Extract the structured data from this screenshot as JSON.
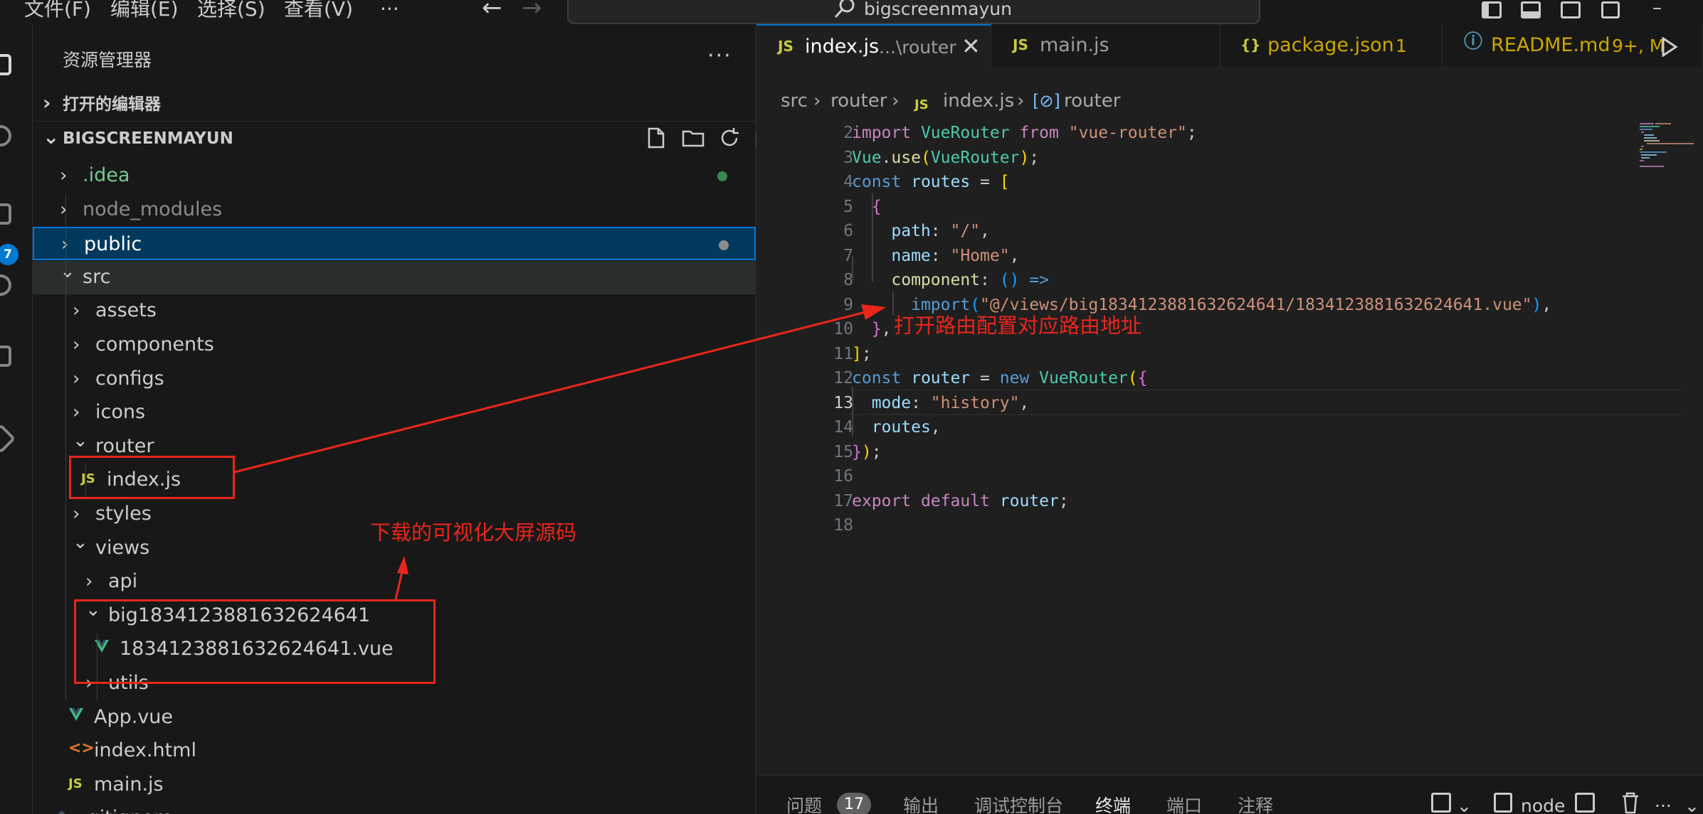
{
  "colors": {
    "accent": "#0078d4",
    "annotation": "#e8261c",
    "background": "#1f1f1f",
    "sidebar_bg": "#181818"
  },
  "titlebar": {
    "menu": [
      "文件(F)",
      "编辑(E)",
      "选择(S)",
      "查看(V)",
      "···"
    ],
    "search_text": "bigscreenmayun",
    "back_icon": "arrow-left-icon",
    "forward_icon": "arrow-right-icon",
    "search_icon": "search-icon",
    "minimize": "–"
  },
  "activitybar": {
    "scm_badge": "7"
  },
  "sidebar": {
    "title": "资源管理器",
    "more": "···",
    "open_editors": "打开的编辑器",
    "project": "BIGSCREENMAYUN",
    "tree": [
      {
        "label": ".idea",
        "type": "folder",
        "expanded": false,
        "depth": 0,
        "color": "#73c991",
        "dot": "#3a8a4f"
      },
      {
        "label": "node_modules",
        "type": "folder",
        "expanded": false,
        "depth": 0,
        "color": "#8c8c8c"
      },
      {
        "label": "public",
        "type": "folder",
        "expanded": false,
        "depth": 0,
        "color": "#ffffff",
        "dot": "#8c8c8c",
        "selected": true
      },
      {
        "label": "src",
        "type": "folder",
        "expanded": true,
        "depth": 0,
        "color": "#cccccc",
        "hover": true
      },
      {
        "label": "assets",
        "type": "folder",
        "expanded": false,
        "depth": 1,
        "color": "#cccccc"
      },
      {
        "label": "components",
        "type": "folder",
        "expanded": false,
        "depth": 1,
        "color": "#cccccc"
      },
      {
        "label": "configs",
        "type": "folder",
        "expanded": false,
        "depth": 1,
        "color": "#cccccc"
      },
      {
        "label": "icons",
        "type": "folder",
        "expanded": false,
        "depth": 1,
        "color": "#cccccc"
      },
      {
        "label": "router",
        "type": "folder",
        "expanded": true,
        "depth": 1,
        "color": "#cccccc"
      },
      {
        "label": "index.js",
        "type": "js",
        "depth": 2,
        "color": "#cccccc"
      },
      {
        "label": "styles",
        "type": "folder",
        "expanded": false,
        "depth": 1,
        "color": "#cccccc"
      },
      {
        "label": "views",
        "type": "folder",
        "expanded": true,
        "depth": 1,
        "color": "#cccccc"
      },
      {
        "label": "api",
        "type": "folder",
        "expanded": false,
        "depth": 2,
        "color": "#cccccc"
      },
      {
        "label": "big1834123881632624641",
        "type": "folder",
        "expanded": true,
        "depth": 2,
        "color": "#cccccc"
      },
      {
        "label": "1834123881632624641.vue",
        "type": "vue",
        "depth": 3,
        "color": "#cccccc"
      },
      {
        "label": "utils",
        "type": "folder",
        "expanded": false,
        "depth": 2,
        "color": "#cccccc"
      },
      {
        "label": "App.vue",
        "type": "vue",
        "depth": 1,
        "color": "#cccccc"
      },
      {
        "label": "index.html",
        "type": "html",
        "depth": 1,
        "color": "#cccccc"
      },
      {
        "label": "main.js",
        "type": "js",
        "depth": 1,
        "color": "#cccccc"
      },
      {
        "label": ".gitignore",
        "type": "git",
        "depth": 0,
        "color": "#cccccc"
      }
    ]
  },
  "tabs": [
    {
      "icon": "JS",
      "name": "index.js",
      "desc": "...\\router",
      "active": true,
      "name_color": "#ffffff",
      "close": "✕"
    },
    {
      "icon": "JS",
      "name": "main.js",
      "name_color": "#9d9d9d"
    },
    {
      "icon": "{}",
      "name": "package.json",
      "desc": "1",
      "name_color": "#cca700"
    },
    {
      "icon": "ⓘ",
      "name": "README.md",
      "desc": "9+, M",
      "name_color": "#cca700"
    }
  ],
  "breadcrumb": [
    "src",
    "router",
    "index.js",
    "router"
  ],
  "editor": {
    "current_line": 13,
    "lines": [
      {
        "n": 2,
        "tokens": [
          [
            "k",
            "import"
          ],
          [
            "pl",
            " "
          ],
          [
            "t",
            "VueRouter"
          ],
          [
            "pl",
            " "
          ],
          [
            "k",
            "from"
          ],
          [
            "pl",
            " "
          ],
          [
            "s",
            "\"vue-router\""
          ],
          [
            "pl",
            ";"
          ]
        ]
      },
      {
        "n": 3,
        "tokens": [
          [
            "t",
            "Vue"
          ],
          [
            "pl",
            "."
          ],
          [
            "f",
            "use"
          ],
          [
            "b1",
            "("
          ],
          [
            "t",
            "VueRouter"
          ],
          [
            "b1",
            ")"
          ],
          [
            "pl",
            ";"
          ]
        ]
      },
      {
        "n": 4,
        "tokens": [
          [
            "kw",
            "const"
          ],
          [
            "pl",
            " "
          ],
          [
            "v",
            "routes"
          ],
          [
            "pl",
            " = "
          ],
          [
            "b1",
            "["
          ]
        ]
      },
      {
        "n": 5,
        "tokens": [
          [
            "pl",
            "  "
          ],
          [
            "b2",
            "{"
          ]
        ]
      },
      {
        "n": 6,
        "tokens": [
          [
            "pl",
            "    "
          ],
          [
            "v",
            "path"
          ],
          [
            "pl",
            ": "
          ],
          [
            "s",
            "\"/\""
          ],
          [
            "pl",
            ","
          ]
        ]
      },
      {
        "n": 7,
        "tokens": [
          [
            "pl",
            "    "
          ],
          [
            "v",
            "name"
          ],
          [
            "pl",
            ": "
          ],
          [
            "s",
            "\"Home\""
          ],
          [
            "pl",
            ","
          ]
        ]
      },
      {
        "n": 8,
        "tokens": [
          [
            "pl",
            "    "
          ],
          [
            "f",
            "component"
          ],
          [
            "pl",
            ": "
          ],
          [
            "b3",
            "()"
          ],
          [
            "pl",
            " "
          ],
          [
            "kw",
            "=>"
          ]
        ]
      },
      {
        "n": 9,
        "tokens": [
          [
            "pl",
            "      "
          ],
          [
            "kw",
            "import"
          ],
          [
            "b3",
            "("
          ],
          [
            "s",
            "\"@/views/big1834123881632624641/1834123881632624641.vue\""
          ],
          [
            "b3",
            ")"
          ],
          [
            "pl",
            ","
          ]
        ]
      },
      {
        "n": 10,
        "tokens": [
          [
            "pl",
            "  "
          ],
          [
            "b2",
            "}"
          ],
          [
            "pl",
            ","
          ]
        ]
      },
      {
        "n": 11,
        "tokens": [
          [
            "b1",
            "]"
          ],
          [
            "pl",
            ";"
          ]
        ]
      },
      {
        "n": 12,
        "tokens": [
          [
            "kw",
            "const"
          ],
          [
            "pl",
            " "
          ],
          [
            "v",
            "router"
          ],
          [
            "pl",
            " = "
          ],
          [
            "kw",
            "new"
          ],
          [
            "pl",
            " "
          ],
          [
            "t",
            "VueRouter"
          ],
          [
            "b1",
            "("
          ],
          [
            "b2",
            "{"
          ]
        ]
      },
      {
        "n": 13,
        "tokens": [
          [
            "pl",
            "  "
          ],
          [
            "v",
            "mode"
          ],
          [
            "pl",
            ": "
          ],
          [
            "s",
            "\"history\""
          ],
          [
            "pl",
            ","
          ]
        ]
      },
      {
        "n": 14,
        "tokens": [
          [
            "pl",
            "  "
          ],
          [
            "v",
            "routes"
          ],
          [
            "pl",
            ","
          ]
        ]
      },
      {
        "n": 15,
        "tokens": [
          [
            "b2",
            "}"
          ],
          [
            "b1",
            ")"
          ],
          [
            "pl",
            ";"
          ]
        ]
      },
      {
        "n": 16,
        "tokens": []
      },
      {
        "n": 17,
        "tokens": [
          [
            "k",
            "export"
          ],
          [
            "pl",
            " "
          ],
          [
            "k",
            "default"
          ],
          [
            "pl",
            " "
          ],
          [
            "v",
            "router"
          ],
          [
            "pl",
            ";"
          ]
        ]
      },
      {
        "n": 18,
        "tokens": []
      }
    ]
  },
  "panel": {
    "tabs": [
      "问题",
      "输出",
      "调试控制台",
      "终端",
      "端口",
      "注释"
    ],
    "active": "终端",
    "problems_count": "17",
    "terminal_name": "node",
    "more": "···"
  },
  "annotations": {
    "router_note": "打开路由配置对应路由地址",
    "download_note": "下载的可视化大屏源码"
  }
}
